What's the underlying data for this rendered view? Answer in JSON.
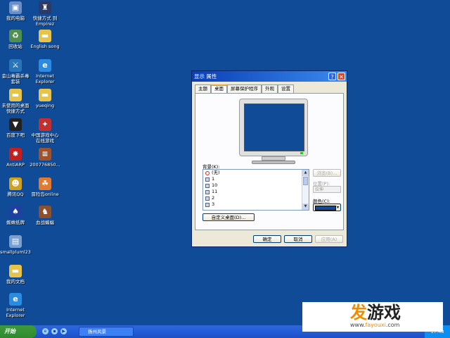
{
  "desktop_icons": [
    {
      "id": "my-computer",
      "label": "我的电脑",
      "label2": "",
      "color": "#6b8ec9",
      "glyph": "▣"
    },
    {
      "id": "shortcut-empirez",
      "label": "快捷方式 到",
      "label2": "Empirez",
      "color": "#2b3a66",
      "glyph": "♜"
    },
    {
      "id": "recycle-bin",
      "label": "回收站",
      "label2": "",
      "color": "#4f8f4f",
      "glyph": "♻"
    },
    {
      "id": "english-song",
      "label": "English song",
      "label2": "",
      "color": "#e6c34a",
      "glyph": "▬"
    },
    {
      "id": "jinshan-antivirus",
      "label": "金山毒霸杀毒",
      "label2": "套装",
      "color": "#2a74b8",
      "glyph": "⚔"
    },
    {
      "id": "internet-explorer",
      "label": "Internet",
      "label2": "Explorer",
      "color": "#2a8be0",
      "glyph": "e"
    },
    {
      "id": "unused-desktop-shortcuts",
      "label": "未使用的桌面",
      "label2": "快捷方式",
      "color": "#e6c34a",
      "glyph": "▬"
    },
    {
      "id": "yueqing",
      "label": "yueqing",
      "label2": "",
      "color": "#e6c34a",
      "glyph": "▬"
    },
    {
      "id": "baidu-download",
      "label": "百度下吧",
      "label2": "",
      "color": "#222",
      "glyph": "▼"
    },
    {
      "id": "china-game-center",
      "label": "中国游戏中心",
      "label2": "在线游戏",
      "color": "#c03030",
      "glyph": "✦"
    },
    {
      "id": "antiarp",
      "label": "AntiARP",
      "label2": "",
      "color": "#c02020",
      "glyph": "✸"
    },
    {
      "id": "file-200776850",
      "label": "200776850...",
      "label2": "",
      "color": "#a0522d",
      "glyph": "≡"
    },
    {
      "id": "tencent-qq",
      "label": "腾讯QQ",
      "label2": "",
      "color": "#d0a020",
      "glyph": "☻"
    },
    {
      "id": "adventure-island",
      "label": "冒险岛online",
      "label2": "",
      "color": "#e07a30",
      "glyph": "☘"
    },
    {
      "id": "spider-solitaire",
      "label": "蜘蛛纸牌",
      "label2": "",
      "color": "#2040a0",
      "glyph": "♠"
    },
    {
      "id": "blood-battle",
      "label": "血战蝙蝠",
      "label2": "",
      "color": "#8a5030",
      "glyph": "♞"
    },
    {
      "id": "smallpluml23",
      "label": "smallpluml23",
      "label2": "",
      "color": "#7aa0d0",
      "glyph": "▤"
    },
    {
      "id": "my-documents",
      "label": "我的文档",
      "label2": "",
      "color": "#e6c34a",
      "glyph": "▬"
    },
    {
      "id": "internet-explorer-2",
      "label": "Internet",
      "label2": "Explorer",
      "color": "#2a8be0",
      "glyph": "e"
    }
  ],
  "dialog": {
    "title": "显示 属性",
    "help_btn": "?",
    "close_btn": "✕",
    "tabs": [
      "主题",
      "桌面",
      "屏幕保护程序",
      "外观",
      "设置"
    ],
    "active_tab": "桌面",
    "background_label": "背景(K):",
    "background_items": [
      "(无)",
      "1",
      "10",
      "11",
      "2",
      "3"
    ],
    "selected_background": "(无)",
    "customize_button": "自定义桌面(D)...",
    "browse_button": "浏览(B)...",
    "position_label": "位置(P):",
    "position_value": "拉伸",
    "color_label": "颜色(C):",
    "color_value": "#0f4b96",
    "ok_button": "确定",
    "cancel_button": "取消",
    "apply_button": "应用(A)"
  },
  "taskbar": {
    "start_label": "开始",
    "task_label": "扬州风景",
    "clock": "17:48"
  },
  "watermark": {
    "text_orange": "发",
    "text_dark": "游戏",
    "url_prefix": "www.",
    "url_highlight": "fayouxi",
    "url_suffix": ".com"
  }
}
